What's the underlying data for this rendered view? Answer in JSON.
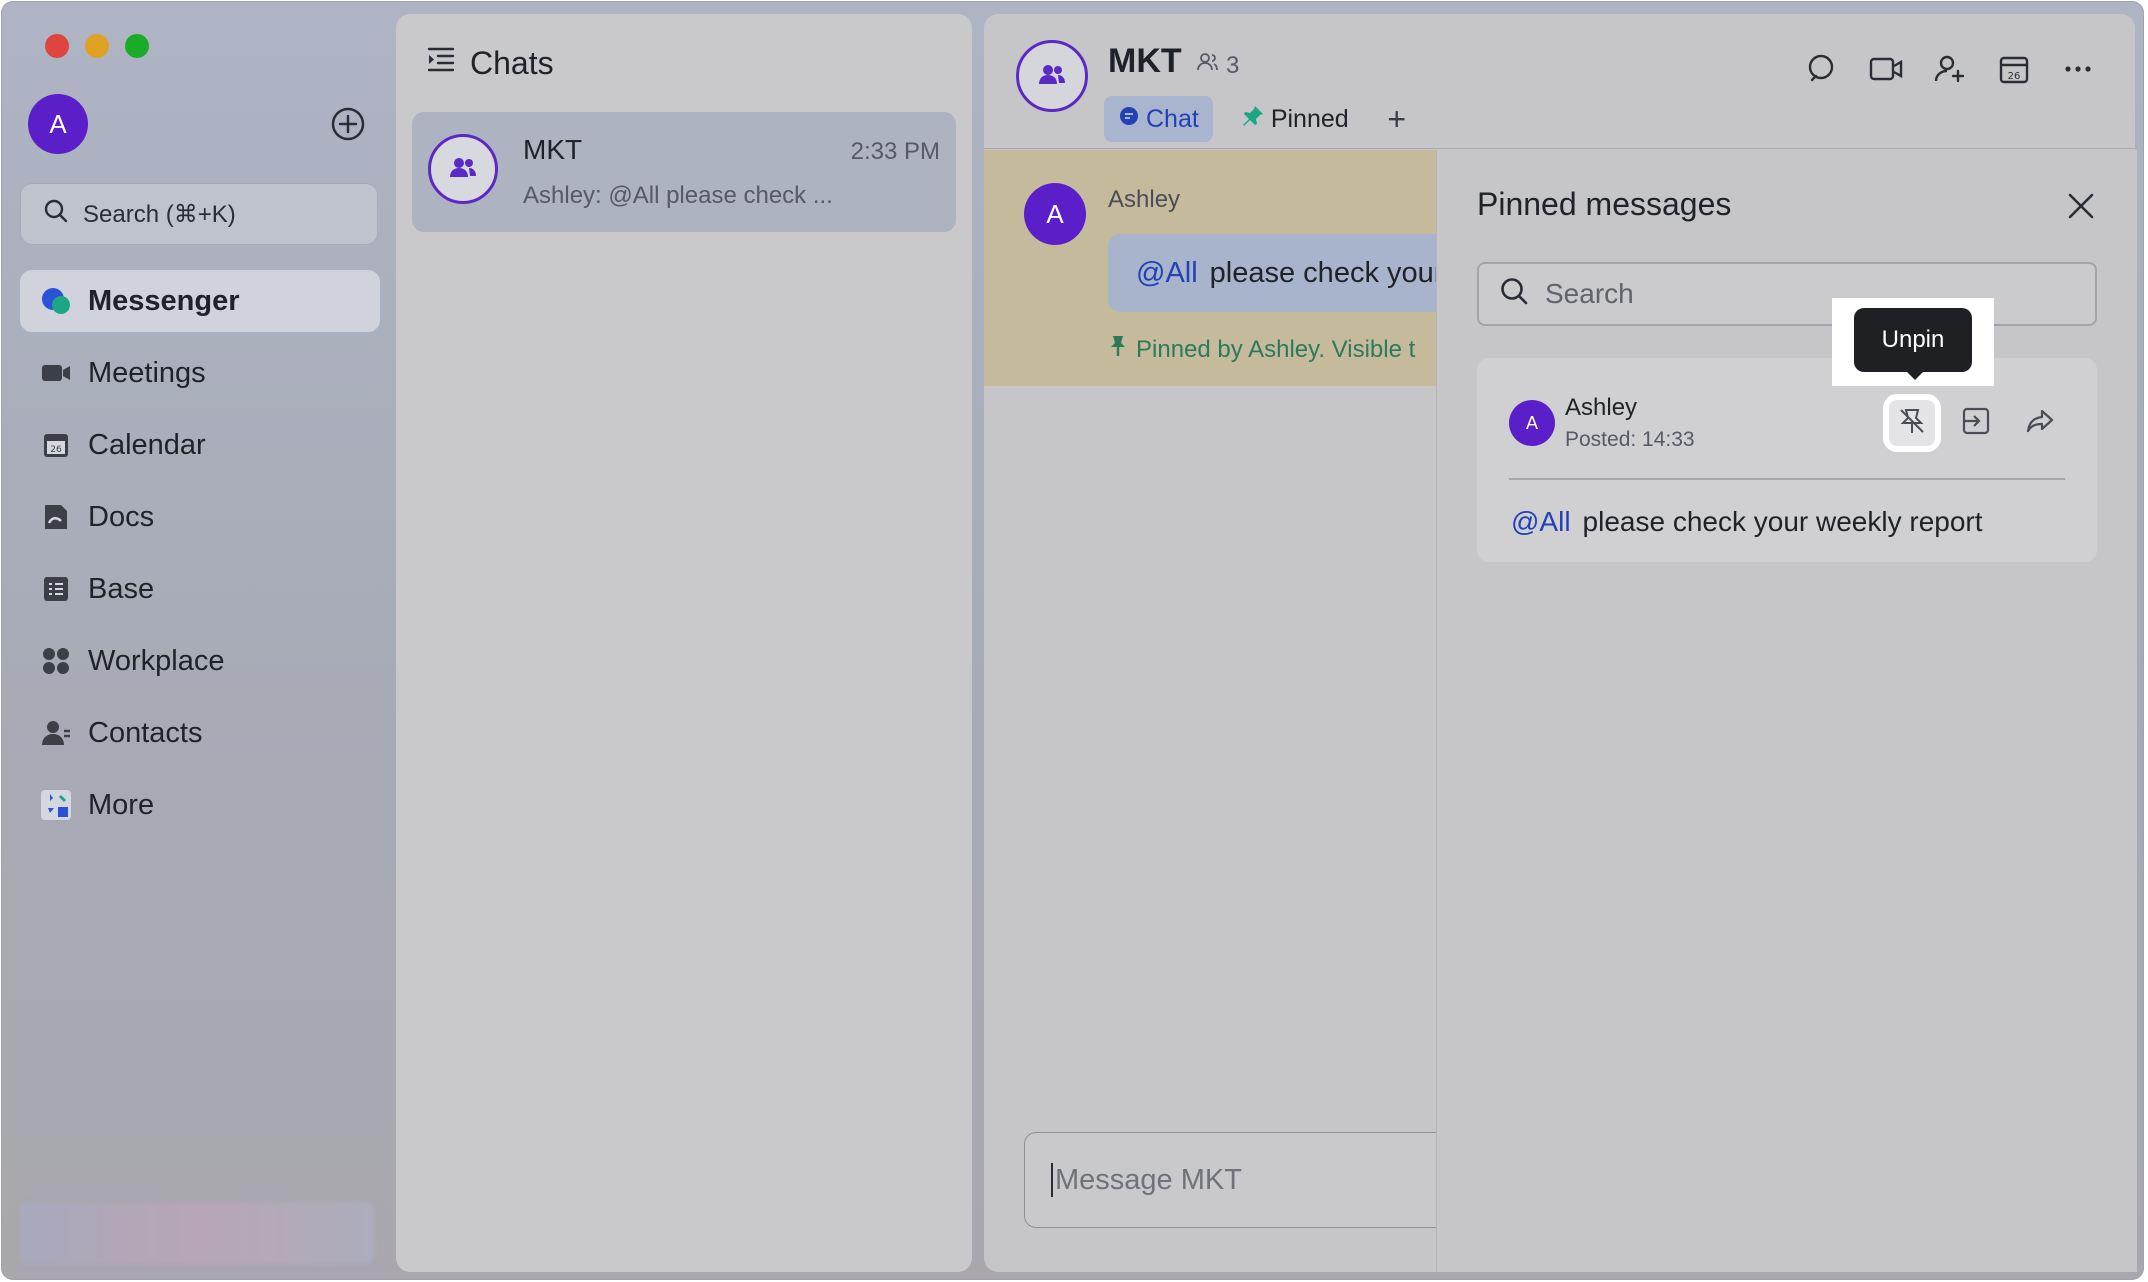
{
  "sidebar": {
    "avatar_initial": "A",
    "search_placeholder": "Search (⌘+K)",
    "items": [
      {
        "label": "Messenger",
        "icon": "messenger-icon",
        "active": true
      },
      {
        "label": "Meetings",
        "icon": "video-camera-icon"
      },
      {
        "label": "Calendar",
        "icon": "calendar-icon"
      },
      {
        "label": "Docs",
        "icon": "docs-icon"
      },
      {
        "label": "Base",
        "icon": "base-icon"
      },
      {
        "label": "Workplace",
        "icon": "workplace-icon"
      },
      {
        "label": "Contacts",
        "icon": "contacts-icon"
      },
      {
        "label": "More",
        "icon": "more-apps-icon"
      }
    ]
  },
  "chats": {
    "title": "Chats",
    "list": [
      {
        "name": "MKT",
        "time": "2:33 PM",
        "preview": "Ashley: @All please check ..."
      }
    ]
  },
  "conversation": {
    "name": "MKT",
    "member_count": "3",
    "tabs": [
      {
        "label": "Chat",
        "active": true
      },
      {
        "label": "Pinned"
      }
    ],
    "message": {
      "avatar_initial": "A",
      "sender": "Ashley",
      "mention": "@All",
      "text": "please check your",
      "pin_note": "Pinned by Ashley. Visible t"
    },
    "composer_placeholder": "Message MKT"
  },
  "pinned_panel": {
    "title": "Pinned messages",
    "search_placeholder": "Search",
    "tooltip": "Unpin",
    "item": {
      "avatar_initial": "A",
      "sender": "Ashley",
      "posted": "Posted: 14:33",
      "mention": "@All",
      "text": "please check your weekly report"
    }
  },
  "colors": {
    "accent": "#2141b5",
    "avatar": "#5b1fc9",
    "pin_green": "#2d7a5a"
  }
}
